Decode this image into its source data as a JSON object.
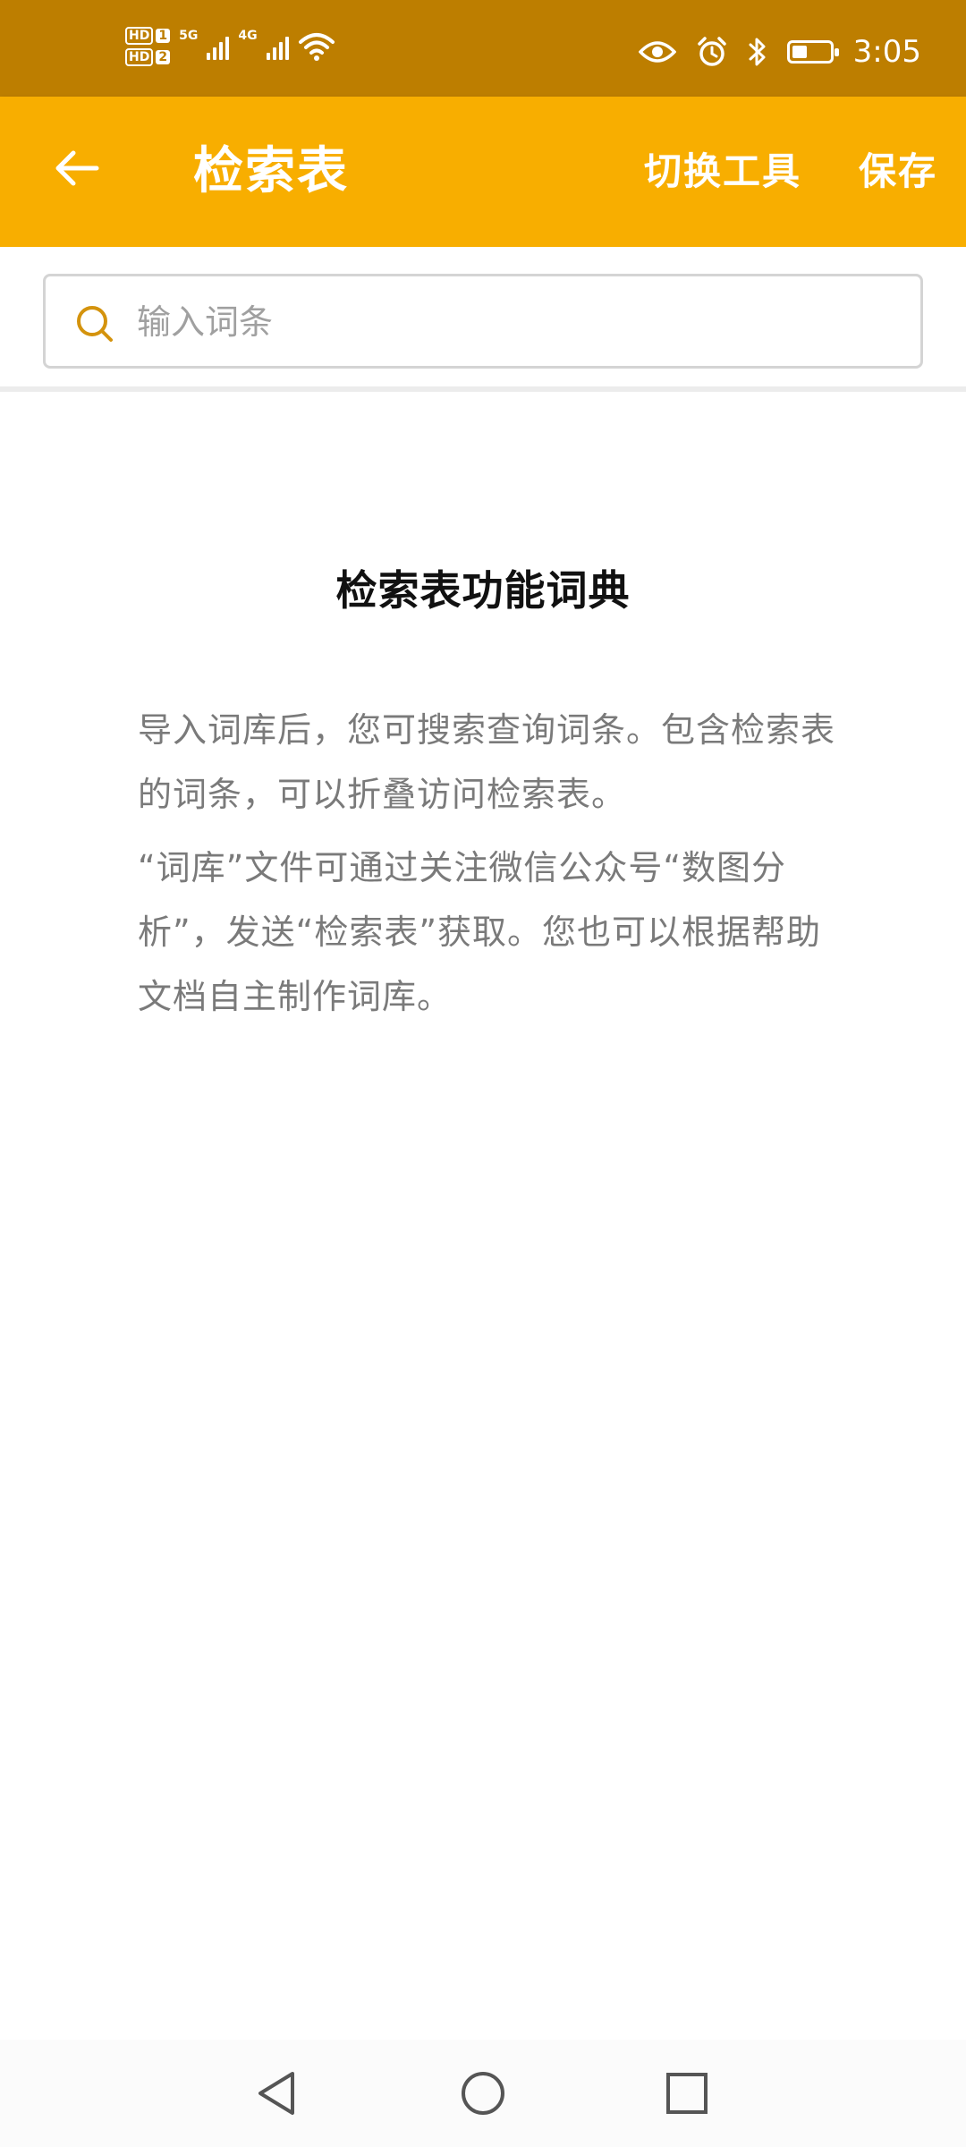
{
  "status_bar": {
    "sim1_label": "HD",
    "sim1_num": "1",
    "sim2_label": "HD",
    "sim2_num": "2",
    "network1": "5G",
    "network2": "4G",
    "time": "3:05",
    "battery_percent": 40,
    "icons": [
      "eye-icon",
      "alarm-icon",
      "bluetooth-icon",
      "battery-icon",
      "wifi-icon"
    ]
  },
  "app_bar": {
    "title": "检索表",
    "switch_tool_label": "切换工具",
    "save_label": "保存",
    "background_color": "#F8AE00"
  },
  "search": {
    "placeholder": "输入词条",
    "value": ""
  },
  "content": {
    "title": "检索表功能词典",
    "paragraph1": "导入词库后，您可搜索查询词条。包含检索表的词条，可以折叠访问检索表。",
    "paragraph2": "“词库”文件可通过关注微信公众号“数图分析”，发送“检索表”获取。您也可以根据帮助文档自主制作词库。"
  },
  "colors": {
    "status_bar": "#BD7E00",
    "accent": "#F8AE00",
    "search_icon": "#D4930D",
    "body_text": "#7A7A7A"
  }
}
